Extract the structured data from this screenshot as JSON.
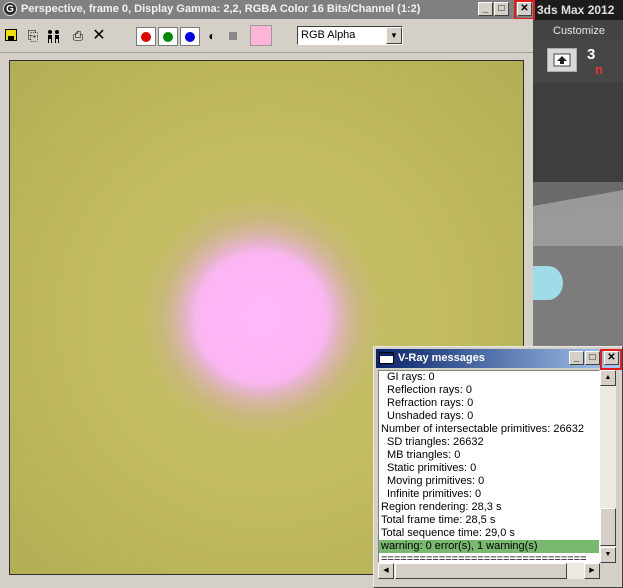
{
  "max_app": {
    "title": "3ds Max  2012",
    "menu_item": "Customize",
    "snap_label": "3",
    "magnet_label": "n"
  },
  "frame_buffer": {
    "title": "Perspective, frame 0, Display Gamma: 2,2, RGBA Color 16 Bits/Channel (1:2)",
    "icon_glyph": "G",
    "caption": {
      "minimize": "_",
      "maximize": "□",
      "close": "✕"
    },
    "toolbar": {
      "icons": [
        "save-icon",
        "copy-icon",
        "clone-icon",
        "print-icon",
        "clear-icon"
      ],
      "copy_glyph": "⎘",
      "clone_glyph": "👪",
      "print_glyph": "⎙",
      "clear_glyph": "✕",
      "mono_glyph": "◐",
      "channel_colors": {
        "red": "#e00000",
        "green": "#008a00",
        "blue": "#0000e0"
      },
      "swatch_color": "#ffb5d7",
      "channel_select": "RGB Alpha",
      "dropdown_glyph": "▼"
    },
    "render": {
      "background_color": "#c2bd5e",
      "sphere_color": "#ffb6f8"
    }
  },
  "vray": {
    "title": "V-Ray messages",
    "caption": {
      "minimize": "_",
      "maximize": "□",
      "close": "✕"
    },
    "log": [
      {
        "text": "GI rays: 0",
        "indent": true
      },
      {
        "text": "Reflection rays: 0",
        "indent": true
      },
      {
        "text": "Refraction rays: 0",
        "indent": true
      },
      {
        "text": "Unshaded rays: 0",
        "indent": true
      },
      {
        "text": "Number of intersectable primitives: 26632",
        "indent": false
      },
      {
        "text": "SD triangles: 26632",
        "indent": true
      },
      {
        "text": "MB triangles: 0",
        "indent": true
      },
      {
        "text": "Static primitives: 0",
        "indent": true
      },
      {
        "text": "Moving primitives: 0",
        "indent": true
      },
      {
        "text": "Infinite primitives: 0",
        "indent": true
      },
      {
        "text": "Region rendering: 28,3 s",
        "indent": false
      },
      {
        "text": "Total frame time: 28,5 s",
        "indent": false
      },
      {
        "text": "Total sequence time: 29,0 s",
        "indent": false
      },
      {
        "text": "warning: 0 error(s), 1 warning(s)",
        "indent": false,
        "highlight": true
      },
      {
        "text": "================================",
        "indent": false
      }
    ],
    "scroll_glyphs": {
      "up": "▲",
      "down": "▼",
      "left": "◀",
      "right": "▶"
    },
    "highlight_color": "#78b86f"
  }
}
